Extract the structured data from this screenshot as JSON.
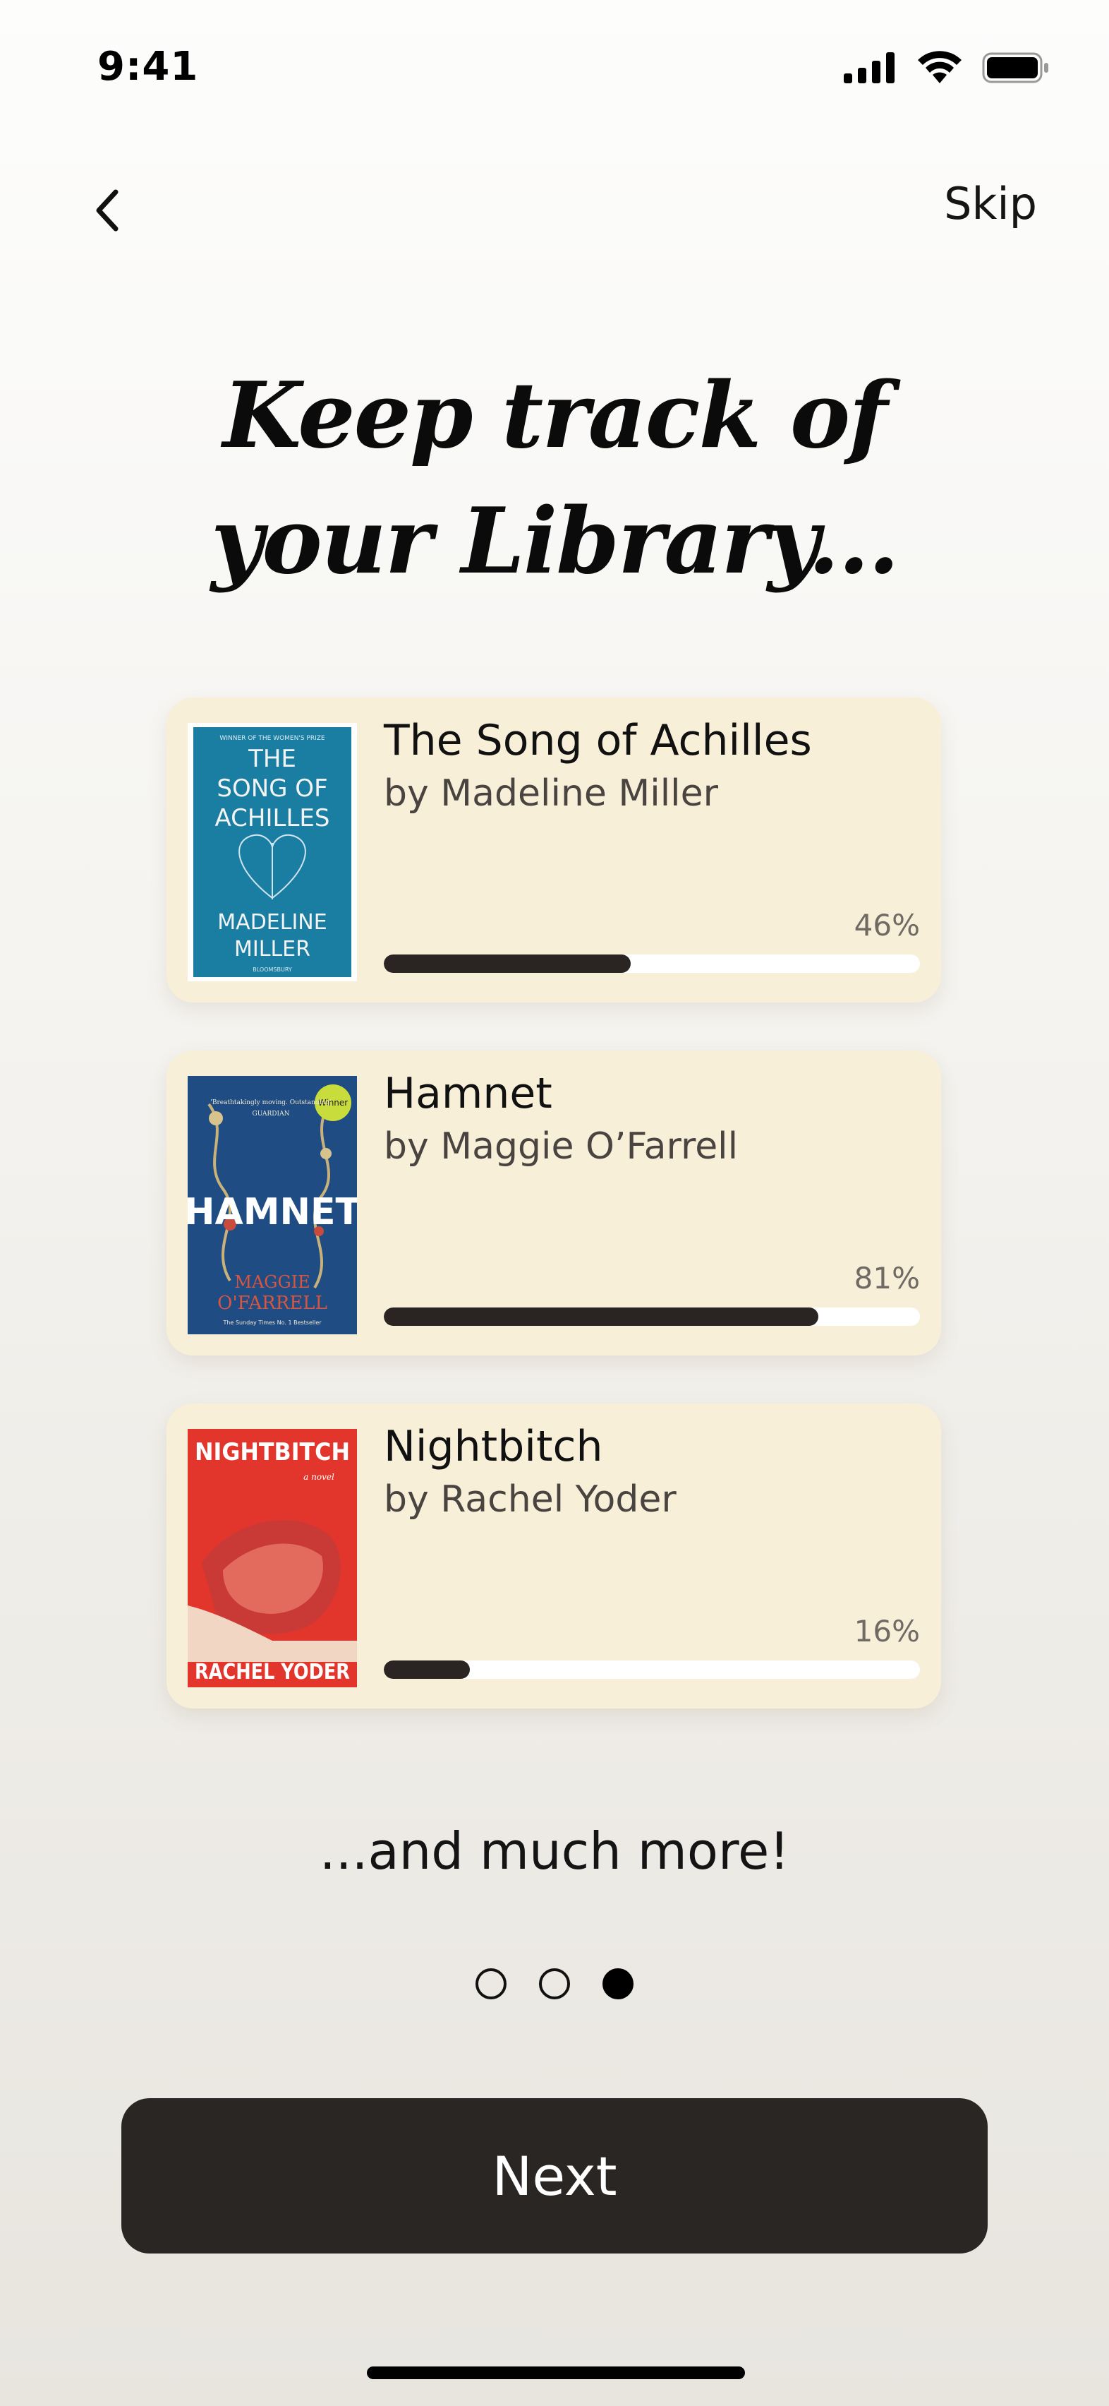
{
  "status_bar": {
    "time": "9:41"
  },
  "nav": {
    "skip_label": "Skip"
  },
  "title": {
    "line1": "Keep track of",
    "line2": "your Library..."
  },
  "books": [
    {
      "title": "The Song of Achilles",
      "author": "by Madeline Miller",
      "progress": 46,
      "progress_label": "46%",
      "cover": {
        "top_text": "WINNER OF THE WOMEN'S PRIZE",
        "title_lines": [
          "THE",
          "SONG OF",
          "ACHILLES"
        ],
        "author_lines": [
          "MADELINE",
          "MILLER"
        ],
        "publisher": "BLOOMSBURY",
        "background": "#1a7ea3"
      }
    },
    {
      "title": "Hamnet",
      "author": "by Maggie O’Farrell",
      "progress": 81,
      "progress_label": "81%",
      "cover": {
        "title_text": "HAMNET",
        "badge_text": "Winner",
        "quote_text": "'Breathtakingly moving. Outstanding'",
        "source_text": "GUARDIAN",
        "author_lines": [
          "MAGGIE",
          "O'FARRELL"
        ],
        "footer_text": "The Sunday Times No. 1 Bestseller",
        "background": "#1f4c82"
      }
    },
    {
      "title": "Nightbitch",
      "author": "by Rachel Yoder",
      "progress": 16,
      "progress_label": "16%",
      "cover": {
        "title_text": "NIGHTBITCH",
        "subtitle_text": "a novel",
        "author_text": "RACHEL YODER",
        "background": "#e2352b"
      }
    }
  ],
  "more_text": "...and much more!",
  "pagination": {
    "total": 3,
    "active_index": 2
  },
  "next_label": "Next",
  "colors": {
    "card_background": "#f8efd9",
    "progress_fill": "#2a2523",
    "button_background": "#2a2624"
  }
}
